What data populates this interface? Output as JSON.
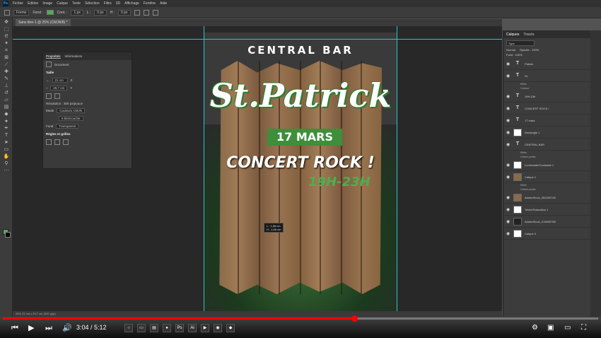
{
  "menu": {
    "logo": "Ps",
    "items": [
      "Fichier",
      "Edition",
      "Image",
      "Calque",
      "Texte",
      "Sélection",
      "Filtre",
      "3D",
      "Affichage",
      "Fenêtre",
      "Aide"
    ]
  },
  "options": {
    "shape": "Forme",
    "fill_label": "Fond :",
    "stroke_label": "Cont. :",
    "stroke_size": "1 px",
    "w_label": "L :",
    "w_value": "0 px",
    "h_label": "H :",
    "h_value": "0 px",
    "fill_color": "#4caf50"
  },
  "document_tab": "Sans titre-1 @ 25% (CMJN/8) *",
  "poster": {
    "top_text": "CENTRAL BAR",
    "title": "St.Patrick",
    "date": "17 MARS",
    "subtitle": "CONCERT ROCK !",
    "hours": "19H-23H",
    "accent_color": "#4caf50"
  },
  "measure": {
    "line1": "L : 1,56 cm",
    "line2": "H : 1,66 cm"
  },
  "properties_panel": {
    "tabs": [
      "Propriétés",
      "Informations"
    ],
    "doc_label": "Document",
    "section_canvas": "Taille",
    "w_value": "21 cm",
    "h_value": "29,7 cm",
    "x_label": "X",
    "y_label": "Y",
    "resolution": "Résolution : 300 px/pouce",
    "mode_label": "Mode",
    "mode_value": "Couleurs CMJN",
    "bits_value": "8 bits/couche",
    "bg_label": "Fond",
    "bg_value": "Transparent",
    "grid_section": "Règles et grilles"
  },
  "layers_panel": {
    "tabs": [
      "Calques",
      "Tracés"
    ],
    "filter": "Type",
    "blend": "Normal",
    "opacity": "Opacité : 100%",
    "fill": "Fond : 100%",
    "rows": [
      {
        "name": "Patrick",
        "kind": "T",
        "fx": "fx"
      },
      {
        "name": "St.",
        "kind": "T",
        "fx": "fx"
      },
      {
        "name": "Effets",
        "kind": "sub"
      },
      {
        "name": "Contour",
        "kind": "sub"
      },
      {
        "name": "19H-23h",
        "kind": "T",
        "fx": "fx"
      },
      {
        "name": "CONCERT ROCK !",
        "kind": "T",
        "fx": ""
      },
      {
        "name": "17 mars",
        "kind": "T",
        "fx": ""
      },
      {
        "name": "Rectangle 1",
        "kind": "shape",
        "fx": ""
      },
      {
        "name": "CENTRAL BAR",
        "kind": "T",
        "fx": "fx"
      },
      {
        "name": "Effets",
        "kind": "sub"
      },
      {
        "name": "Ombre portée",
        "kind": "sub"
      },
      {
        "name": "Luminosité/Contraste 1",
        "kind": "adj",
        "fx": ""
      },
      {
        "name": "Calque 1",
        "kind": "img",
        "fx": "fx"
      },
      {
        "name": "Effets",
        "kind": "sub"
      },
      {
        "name": "Ombre portée",
        "kind": "sub"
      },
      {
        "name": "AdobeStock_282303745",
        "kind": "img",
        "fx": ""
      },
      {
        "name": "Teinte/Saturation 1",
        "kind": "adj",
        "fx": ""
      },
      {
        "name": "AdobeStock_219609785",
        "kind": "dark",
        "fx": ""
      },
      {
        "name": "Calque 0",
        "kind": "shape",
        "fx": ""
      }
    ]
  },
  "status": "25%     21 cm x 29,7 cm (300 ppp)",
  "video": {
    "time": "3:04 / 5:12",
    "progress": 0.59
  }
}
